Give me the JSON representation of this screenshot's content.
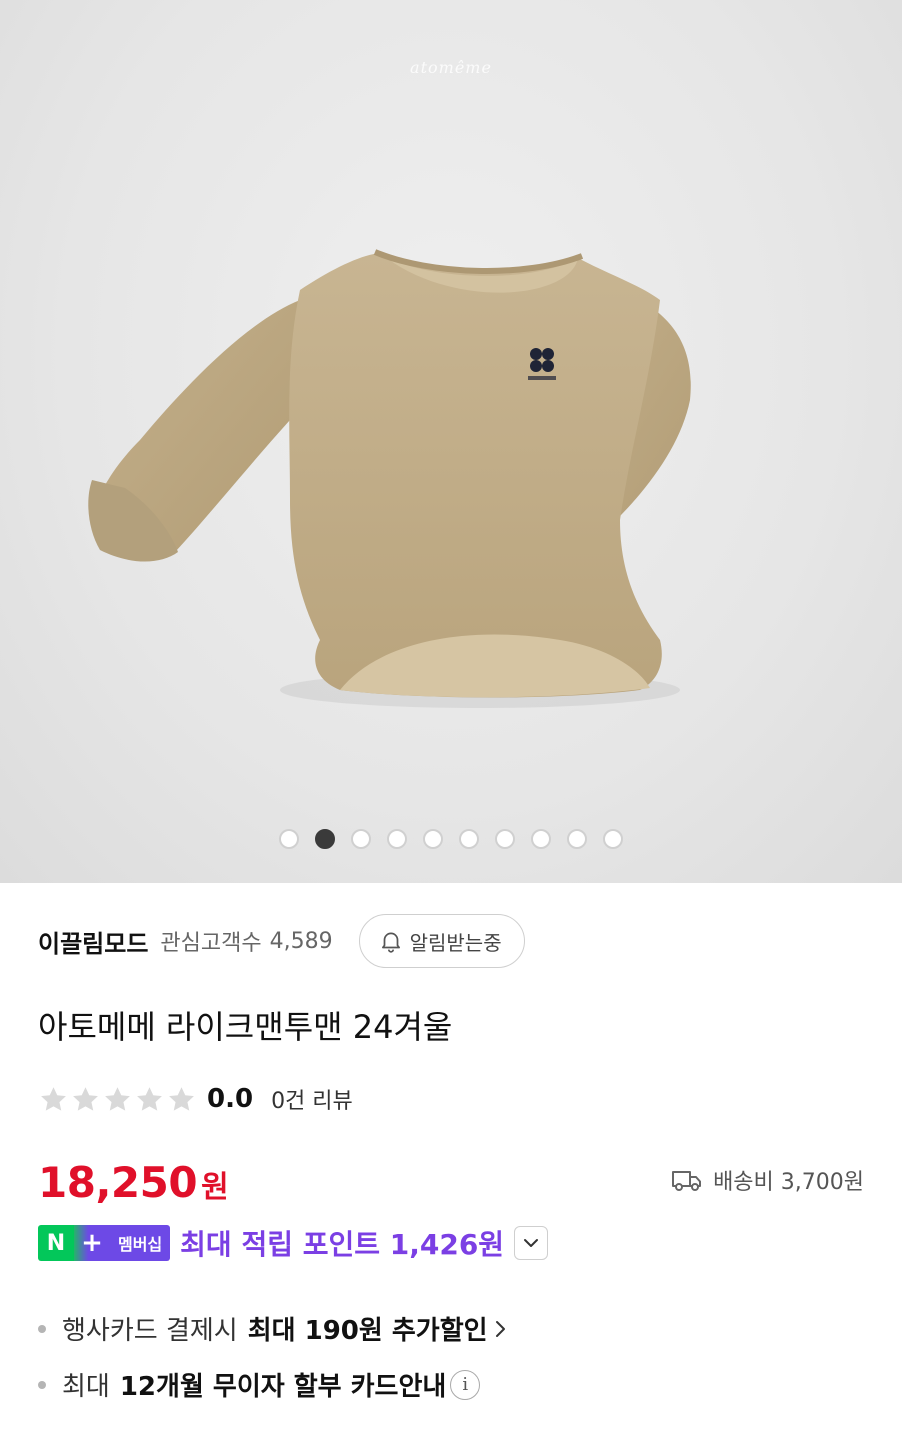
{
  "hero": {
    "watermark": "atomême",
    "slide_count": 10,
    "active_slide": 2
  },
  "store": {
    "name": "이끌림모드",
    "fan_label": "관심고객수",
    "fan_count": "4,589",
    "alert_button": "알림받는중"
  },
  "product": {
    "title": "아토메메 라이크맨투맨 24겨울",
    "rating": "0.0",
    "rating_stars": 0,
    "review_count": "0건 리뷰"
  },
  "price": {
    "value": "18,250",
    "unit": "원"
  },
  "shipping": {
    "label": "배송비 3,700원"
  },
  "membership": {
    "badge_n": "N",
    "badge_plus": "+",
    "badge_member": "멤버십",
    "points_text": "최대 적립 포인트 1,426원"
  },
  "benefits": {
    "card_prefix": "행사카드 결제시",
    "card_bold": "최대 190원 추가할인",
    "installment_prefix": "최대",
    "installment_bold": "12개월 무이자 할부 카드안내",
    "info_glyph": "i"
  },
  "colors": {
    "price": "#e0102a",
    "points": "#7b3fe4",
    "npay_green": "#03c75a",
    "member_purple": "#6d49e6",
    "sweater": "#c2ae88"
  },
  "icons": [
    "bell-icon",
    "truck-icon",
    "chevron-down-icon",
    "chevron-right-icon",
    "info-icon",
    "star-icon"
  ]
}
